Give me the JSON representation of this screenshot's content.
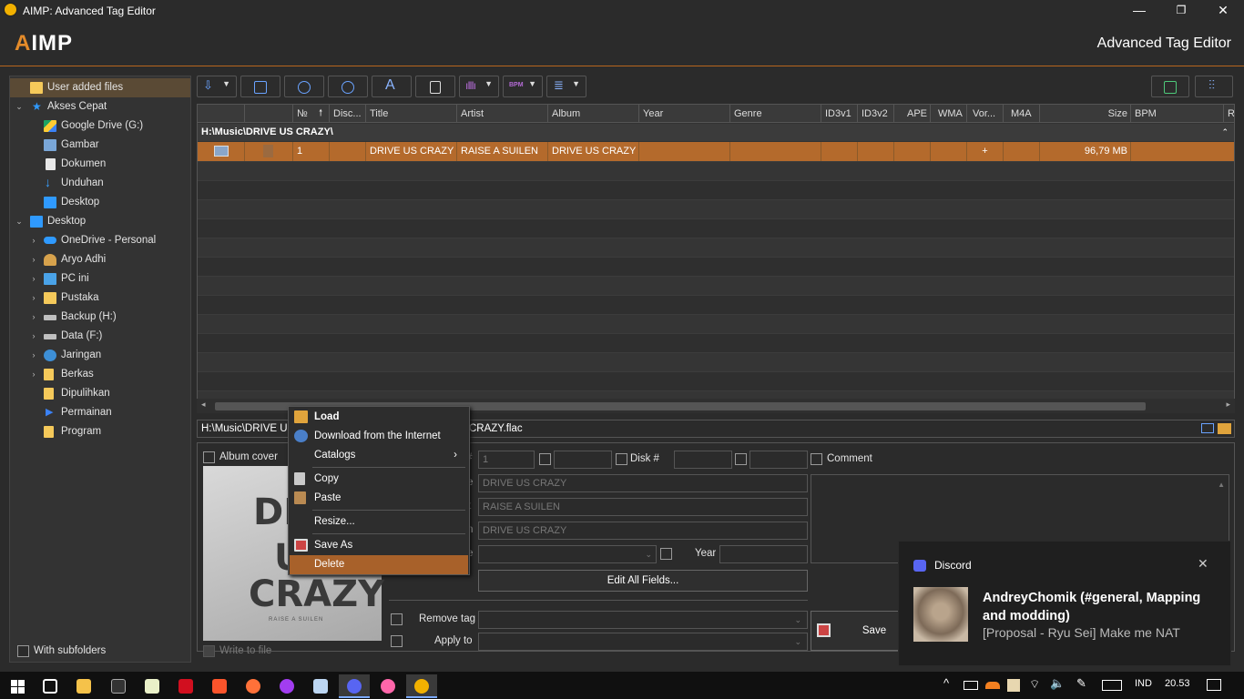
{
  "window": {
    "title": "AIMP: Advanced Tag Editor",
    "min": "—",
    "max": "❐",
    "close": "✕"
  },
  "brand": {
    "logo_accent": "A",
    "logo_rest": "IMP",
    "app_title": "Advanced Tag Editor",
    "accent": "#e48b2a"
  },
  "sidebar": {
    "items": [
      {
        "label": "User added files"
      },
      {
        "label": "Akses Cepat"
      },
      {
        "label": "Google Drive (G:)"
      },
      {
        "label": "Gambar"
      },
      {
        "label": "Dokumen"
      },
      {
        "label": "Unduhan"
      },
      {
        "label": "Desktop"
      },
      {
        "label": "Desktop"
      },
      {
        "label": "OneDrive - Personal"
      },
      {
        "label": "Aryo Adhi"
      },
      {
        "label": "PC ini"
      },
      {
        "label": "Pustaka"
      },
      {
        "label": "Backup (H:)"
      },
      {
        "label": "Data (F:)"
      },
      {
        "label": "Jaringan"
      },
      {
        "label": "Berkas"
      },
      {
        "label": "Dipulihkan"
      },
      {
        "label": "Permainan"
      },
      {
        "label": "Program"
      }
    ],
    "with_subfolders": "With subfolders"
  },
  "toolbar": {
    "bpm_label": "BPM"
  },
  "grid": {
    "columns": [
      "",
      "",
      "№",
      "Disc...",
      "Title",
      "Artist",
      "Album",
      "Year",
      "Genre",
      "ID3v1",
      "ID3v2",
      "APE",
      "WMA",
      "Vor...",
      "M4A",
      "Size",
      "BPM",
      "R"
    ],
    "sort_arrow": "🠕",
    "group": "H:\\Music\\DRIVE US CRAZY\\",
    "row": {
      "num": "1",
      "title": "DRIVE US CRAZY",
      "artist": "RAISE A SUILEN",
      "album": "DRIVE US CRAZY",
      "vorbis": "+",
      "size": "96,79 MB"
    }
  },
  "path": {
    "left": "H:\\Music\\DRIVE US",
    "right": "CRAZY.flac"
  },
  "editor": {
    "album_cover": "Album cover",
    "cover_text": [
      "DRI",
      "US",
      "CRAZY"
    ],
    "cover_small": "RAISE A SUILEN",
    "write_to_file": "Write to file",
    "track_value": "1",
    "disk_label": "Disk #",
    "comment_label": "Comment",
    "title_value": "DRIVE US CRAZY",
    "artist_value": "RAISE A SUILEN",
    "album_value": "DRIVE US CRAZY",
    "year_label": "Year",
    "edit_all": "Edit All Fields...",
    "remove_tag": "Remove tag",
    "apply_to": "Apply to",
    "save": "Save"
  },
  "context_menu": {
    "items": [
      "Load",
      "Download from the Internet",
      "Catalogs",
      "Copy",
      "Paste",
      "Resize...",
      "Save As",
      "Delete"
    ],
    "submenu_arrow": "›"
  },
  "toast": {
    "app": "Discord",
    "title": "AndreyChomik (#general, Mapping and modding)",
    "body": "[Proposal - Ryu Sei] Make me NAT",
    "close": "✕"
  },
  "taskbar": {
    "lang": "IND",
    "time": "20.53"
  }
}
